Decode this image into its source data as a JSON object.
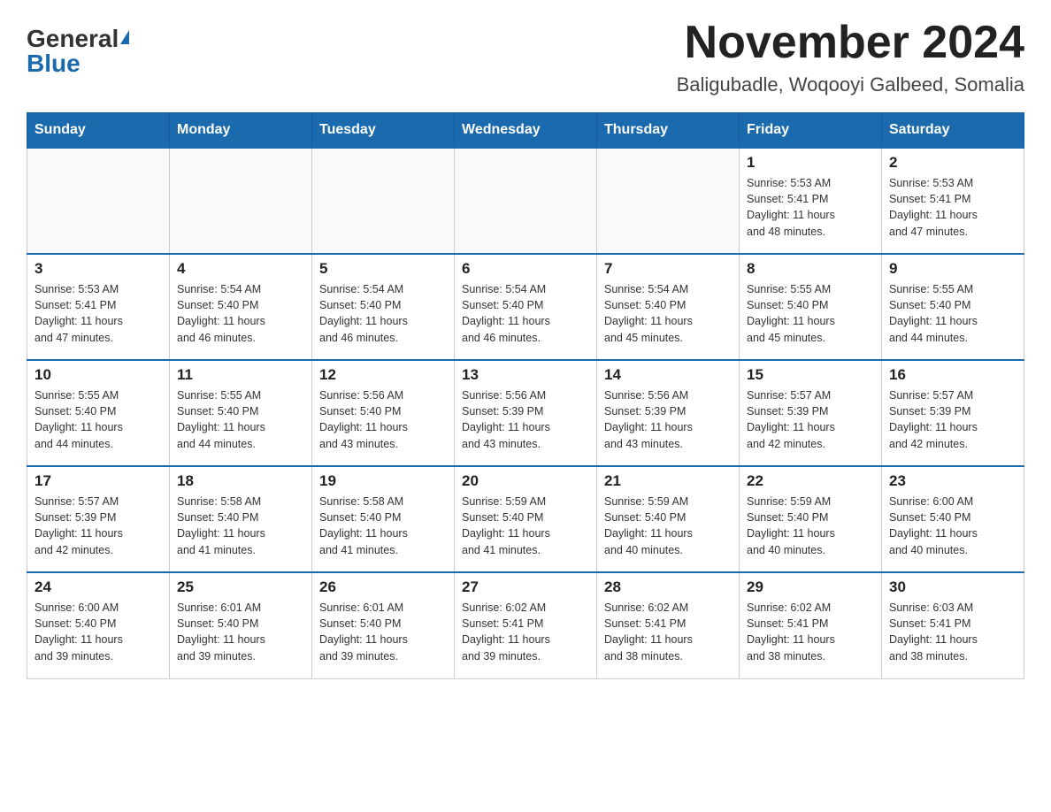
{
  "header": {
    "logo_general": "General",
    "logo_blue": "Blue",
    "main_title": "November 2024",
    "subtitle": "Baligubadle, Woqooyi Galbeed, Somalia"
  },
  "weekdays": [
    "Sunday",
    "Monday",
    "Tuesday",
    "Wednesday",
    "Thursday",
    "Friday",
    "Saturday"
  ],
  "weeks": [
    [
      {
        "day": "",
        "info": ""
      },
      {
        "day": "",
        "info": ""
      },
      {
        "day": "",
        "info": ""
      },
      {
        "day": "",
        "info": ""
      },
      {
        "day": "",
        "info": ""
      },
      {
        "day": "1",
        "info": "Sunrise: 5:53 AM\nSunset: 5:41 PM\nDaylight: 11 hours\nand 48 minutes."
      },
      {
        "day": "2",
        "info": "Sunrise: 5:53 AM\nSunset: 5:41 PM\nDaylight: 11 hours\nand 47 minutes."
      }
    ],
    [
      {
        "day": "3",
        "info": "Sunrise: 5:53 AM\nSunset: 5:41 PM\nDaylight: 11 hours\nand 47 minutes."
      },
      {
        "day": "4",
        "info": "Sunrise: 5:54 AM\nSunset: 5:40 PM\nDaylight: 11 hours\nand 46 minutes."
      },
      {
        "day": "5",
        "info": "Sunrise: 5:54 AM\nSunset: 5:40 PM\nDaylight: 11 hours\nand 46 minutes."
      },
      {
        "day": "6",
        "info": "Sunrise: 5:54 AM\nSunset: 5:40 PM\nDaylight: 11 hours\nand 46 minutes."
      },
      {
        "day": "7",
        "info": "Sunrise: 5:54 AM\nSunset: 5:40 PM\nDaylight: 11 hours\nand 45 minutes."
      },
      {
        "day": "8",
        "info": "Sunrise: 5:55 AM\nSunset: 5:40 PM\nDaylight: 11 hours\nand 45 minutes."
      },
      {
        "day": "9",
        "info": "Sunrise: 5:55 AM\nSunset: 5:40 PM\nDaylight: 11 hours\nand 44 minutes."
      }
    ],
    [
      {
        "day": "10",
        "info": "Sunrise: 5:55 AM\nSunset: 5:40 PM\nDaylight: 11 hours\nand 44 minutes."
      },
      {
        "day": "11",
        "info": "Sunrise: 5:55 AM\nSunset: 5:40 PM\nDaylight: 11 hours\nand 44 minutes."
      },
      {
        "day": "12",
        "info": "Sunrise: 5:56 AM\nSunset: 5:40 PM\nDaylight: 11 hours\nand 43 minutes."
      },
      {
        "day": "13",
        "info": "Sunrise: 5:56 AM\nSunset: 5:39 PM\nDaylight: 11 hours\nand 43 minutes."
      },
      {
        "day": "14",
        "info": "Sunrise: 5:56 AM\nSunset: 5:39 PM\nDaylight: 11 hours\nand 43 minutes."
      },
      {
        "day": "15",
        "info": "Sunrise: 5:57 AM\nSunset: 5:39 PM\nDaylight: 11 hours\nand 42 minutes."
      },
      {
        "day": "16",
        "info": "Sunrise: 5:57 AM\nSunset: 5:39 PM\nDaylight: 11 hours\nand 42 minutes."
      }
    ],
    [
      {
        "day": "17",
        "info": "Sunrise: 5:57 AM\nSunset: 5:39 PM\nDaylight: 11 hours\nand 42 minutes."
      },
      {
        "day": "18",
        "info": "Sunrise: 5:58 AM\nSunset: 5:40 PM\nDaylight: 11 hours\nand 41 minutes."
      },
      {
        "day": "19",
        "info": "Sunrise: 5:58 AM\nSunset: 5:40 PM\nDaylight: 11 hours\nand 41 minutes."
      },
      {
        "day": "20",
        "info": "Sunrise: 5:59 AM\nSunset: 5:40 PM\nDaylight: 11 hours\nand 41 minutes."
      },
      {
        "day": "21",
        "info": "Sunrise: 5:59 AM\nSunset: 5:40 PM\nDaylight: 11 hours\nand 40 minutes."
      },
      {
        "day": "22",
        "info": "Sunrise: 5:59 AM\nSunset: 5:40 PM\nDaylight: 11 hours\nand 40 minutes."
      },
      {
        "day": "23",
        "info": "Sunrise: 6:00 AM\nSunset: 5:40 PM\nDaylight: 11 hours\nand 40 minutes."
      }
    ],
    [
      {
        "day": "24",
        "info": "Sunrise: 6:00 AM\nSunset: 5:40 PM\nDaylight: 11 hours\nand 39 minutes."
      },
      {
        "day": "25",
        "info": "Sunrise: 6:01 AM\nSunset: 5:40 PM\nDaylight: 11 hours\nand 39 minutes."
      },
      {
        "day": "26",
        "info": "Sunrise: 6:01 AM\nSunset: 5:40 PM\nDaylight: 11 hours\nand 39 minutes."
      },
      {
        "day": "27",
        "info": "Sunrise: 6:02 AM\nSunset: 5:41 PM\nDaylight: 11 hours\nand 39 minutes."
      },
      {
        "day": "28",
        "info": "Sunrise: 6:02 AM\nSunset: 5:41 PM\nDaylight: 11 hours\nand 38 minutes."
      },
      {
        "day": "29",
        "info": "Sunrise: 6:02 AM\nSunset: 5:41 PM\nDaylight: 11 hours\nand 38 minutes."
      },
      {
        "day": "30",
        "info": "Sunrise: 6:03 AM\nSunset: 5:41 PM\nDaylight: 11 hours\nand 38 minutes."
      }
    ]
  ]
}
